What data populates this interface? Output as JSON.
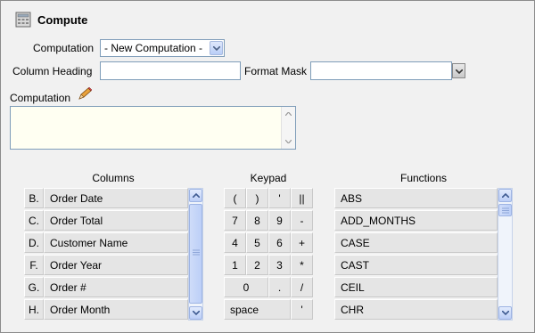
{
  "title": "Compute",
  "form": {
    "computation_label": "Computation",
    "computation_select_value": "- New Computation -",
    "column_heading_label": "Column Heading",
    "column_heading_value": "",
    "format_mask_label": "Format Mask",
    "format_mask_value": "",
    "expression_label": "Computation",
    "expression_value": ""
  },
  "columns": {
    "header": "Columns",
    "items": [
      {
        "key": "B.",
        "name": "Order Date"
      },
      {
        "key": "C.",
        "name": "Order Total"
      },
      {
        "key": "D.",
        "name": "Customer Name"
      },
      {
        "key": "F.",
        "name": "Order Year"
      },
      {
        "key": "G.",
        "name": "Order #"
      },
      {
        "key": "H.",
        "name": "Order Month"
      }
    ]
  },
  "keypad": {
    "header": "Keypad",
    "rows": [
      [
        "(",
        ")",
        "'",
        "||"
      ],
      [
        "7",
        "8",
        "9",
        "-"
      ],
      [
        "4",
        "5",
        "6",
        "+"
      ],
      [
        "1",
        "2",
        "3",
        "*"
      ],
      [
        "0",
        ".",
        "/"
      ],
      [
        "space",
        "'"
      ]
    ]
  },
  "functions": {
    "header": "Functions",
    "items": [
      "ABS",
      "ADD_MONTHS",
      "CASE",
      "CAST",
      "CEIL",
      "CHR"
    ]
  },
  "colors": {
    "background": "#f1f1f1",
    "cell": "#e5e5e5",
    "textarea": "#fffff2",
    "input_border": "#7f9db9"
  }
}
